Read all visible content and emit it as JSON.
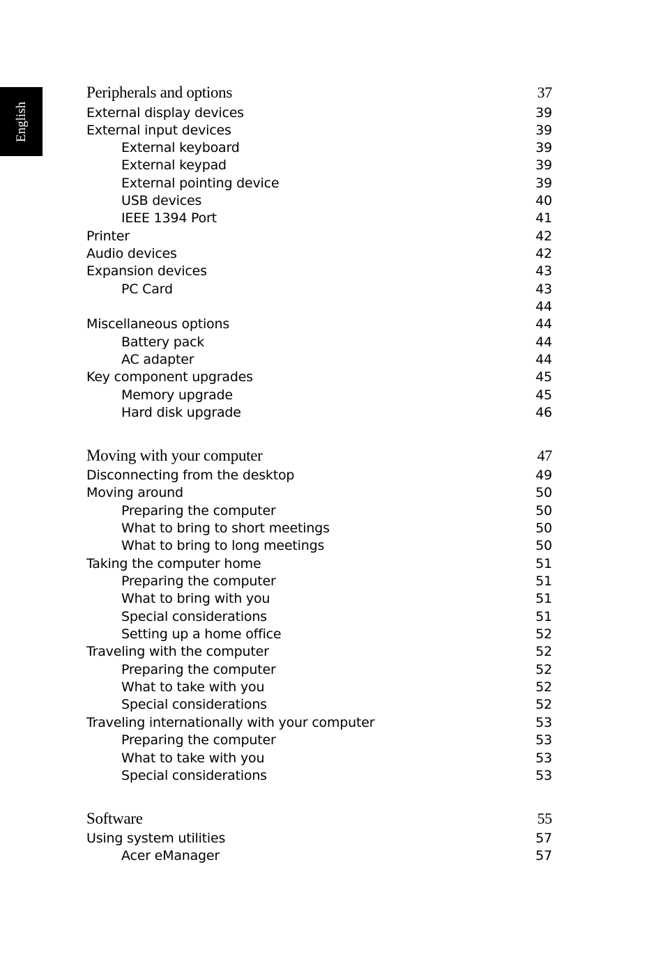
{
  "side_tab": {
    "label": "English",
    "background": "#000000"
  },
  "toc": [
    {
      "level": 0,
      "title": "Peripherals and options",
      "page": "37"
    },
    {
      "level": 1,
      "title": "External display devices",
      "page": "39"
    },
    {
      "level": 1,
      "title": "External input devices",
      "page": "39"
    },
    {
      "level": 2,
      "title": "External keyboard",
      "page": "39"
    },
    {
      "level": 2,
      "title": "External keypad",
      "page": "39"
    },
    {
      "level": 2,
      "title": "External pointing device",
      "page": "39"
    },
    {
      "level": 2,
      "title": "USB devices",
      "page": "40"
    },
    {
      "level": 2,
      "title": "IEEE 1394 Port",
      "page": "41"
    },
    {
      "level": 1,
      "title": "Printer",
      "page": "42"
    },
    {
      "level": 1,
      "title": "Audio devices",
      "page": "42"
    },
    {
      "level": 1,
      "title": "Expansion devices",
      "page": "43"
    },
    {
      "level": 2,
      "title": "PC Card",
      "page": "43"
    },
    {
      "level": 2,
      "title": "",
      "page": "44"
    },
    {
      "level": 1,
      "title": "Miscellaneous options",
      "page": "44"
    },
    {
      "level": 2,
      "title": "Battery pack",
      "page": "44"
    },
    {
      "level": 2,
      "title": "AC adapter",
      "page": "44"
    },
    {
      "level": 1,
      "title": "Key component upgrades",
      "page": "45"
    },
    {
      "level": 2,
      "title": "Memory upgrade",
      "page": "45"
    },
    {
      "level": 2,
      "title": "Hard disk upgrade",
      "page": "46"
    },
    {
      "level": 0,
      "title": "Moving with your computer",
      "page": "47"
    },
    {
      "level": 1,
      "title": "Disconnecting from the desktop",
      "page": "49"
    },
    {
      "level": 1,
      "title": "Moving around",
      "page": "50"
    },
    {
      "level": 2,
      "title": "Preparing the computer",
      "page": "50"
    },
    {
      "level": 2,
      "title": "What to bring to short meetings",
      "page": "50"
    },
    {
      "level": 2,
      "title": "What to bring to long meetings",
      "page": "50"
    },
    {
      "level": 1,
      "title": "Taking the computer home",
      "page": "51"
    },
    {
      "level": 2,
      "title": "Preparing the computer",
      "page": "51"
    },
    {
      "level": 2,
      "title": "What to bring with you",
      "page": "51"
    },
    {
      "level": 2,
      "title": "Special considerations",
      "page": "51"
    },
    {
      "level": 2,
      "title": "Setting up a home office",
      "page": "52"
    },
    {
      "level": 1,
      "title": "Traveling with the computer",
      "page": "52"
    },
    {
      "level": 2,
      "title": "Preparing the computer",
      "page": "52"
    },
    {
      "level": 2,
      "title": "What to take with you",
      "page": "52"
    },
    {
      "level": 2,
      "title": "Special considerations",
      "page": "52"
    },
    {
      "level": 1,
      "title": "Traveling internationally with your computer",
      "page": "53"
    },
    {
      "level": 2,
      "title": "Preparing the computer",
      "page": "53"
    },
    {
      "level": 2,
      "title": "What to take with you",
      "page": "53"
    },
    {
      "level": 2,
      "title": "Special considerations",
      "page": "53"
    },
    {
      "level": 0,
      "title": "Software",
      "page": "55"
    },
    {
      "level": 1,
      "title": "Using system utilities",
      "page": "57"
    },
    {
      "level": 2,
      "title": "Acer eManager",
      "page": "57"
    }
  ]
}
